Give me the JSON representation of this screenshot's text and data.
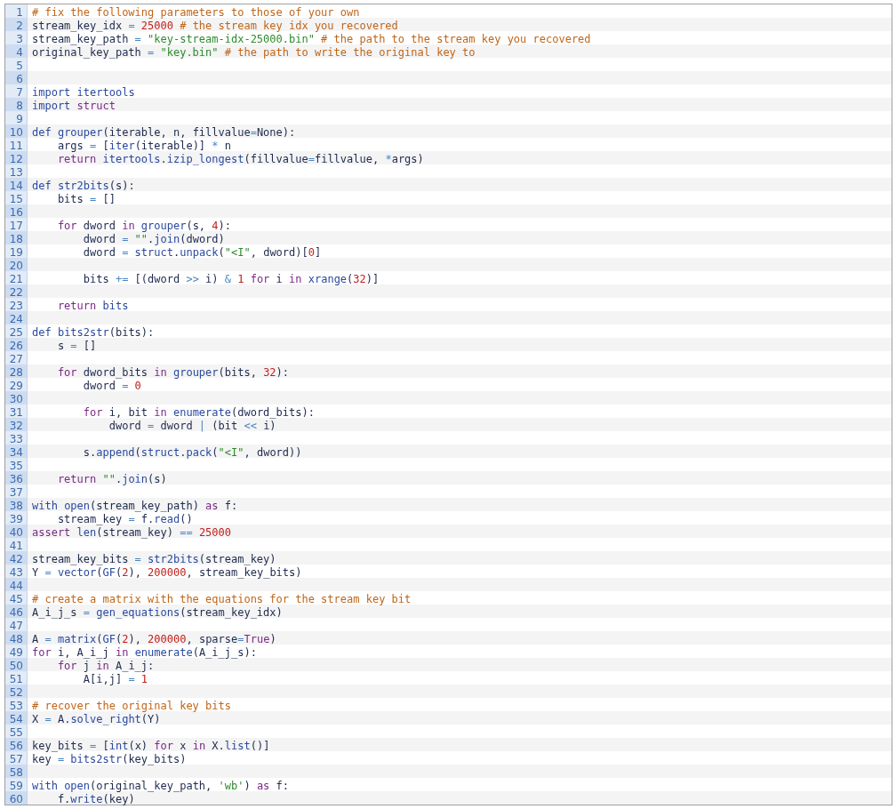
{
  "code_lines": [
    {
      "number": "1",
      "tokens": [
        {
          "kind": "comment",
          "text": "# fix the following parameters to those of your own"
        }
      ]
    },
    {
      "number": "2",
      "tokens": [
        {
          "kind": "text",
          "text": "stream_key_idx "
        },
        {
          "kind": "op",
          "text": "= "
        },
        {
          "kind": "num",
          "text": "25000"
        },
        {
          "kind": "comment",
          "text": " # the stream key idx you recovered"
        }
      ]
    },
    {
      "number": "3",
      "tokens": [
        {
          "kind": "text",
          "text": "stream_key_path "
        },
        {
          "kind": "op",
          "text": "= "
        },
        {
          "kind": "str",
          "text": "\"key-stream-idx-25000.bin\""
        },
        {
          "kind": "comment",
          "text": " # the path to the stream key you recovered"
        }
      ]
    },
    {
      "number": "4",
      "tokens": [
        {
          "kind": "text",
          "text": "original_key_path "
        },
        {
          "kind": "op",
          "text": "= "
        },
        {
          "kind": "str",
          "text": "\"key.bin\""
        },
        {
          "kind": "comment",
          "text": " # the path to write the original key to"
        }
      ]
    },
    {
      "number": "5"
    },
    {
      "number": "6"
    },
    {
      "number": "7",
      "tokens": [
        {
          "kind": "fn",
          "text": "import "
        },
        {
          "kind": "fn",
          "text": "itertools"
        }
      ]
    },
    {
      "number": "8",
      "tokens": [
        {
          "kind": "fn",
          "text": "import "
        },
        {
          "kind": "kw",
          "text": "struct"
        }
      ]
    },
    {
      "number": "9"
    },
    {
      "number": "10",
      "tokens": [
        {
          "kind": "fn",
          "text": "def "
        },
        {
          "kind": "fn",
          "text": "grouper"
        },
        {
          "kind": "text",
          "text": "(iterable, n, fillvalue"
        },
        {
          "kind": "op",
          "text": "="
        },
        {
          "kind": "text",
          "text": "None):"
        }
      ]
    },
    {
      "number": "11",
      "tokens": [
        {
          "kind": "text",
          "text": "    args "
        },
        {
          "kind": "op",
          "text": "="
        },
        {
          "kind": "text",
          "text": " ["
        },
        {
          "kind": "fn",
          "text": "iter"
        },
        {
          "kind": "text",
          "text": "(iterable)] "
        },
        {
          "kind": "op",
          "text": "*"
        },
        {
          "kind": "text",
          "text": " n"
        }
      ]
    },
    {
      "number": "12",
      "tokens": [
        {
          "kind": "kw",
          "text": "    return "
        },
        {
          "kind": "fn",
          "text": "itertools"
        },
        {
          "kind": "text",
          "text": "."
        },
        {
          "kind": "fn",
          "text": "izip_longest"
        },
        {
          "kind": "text",
          "text": "(fillvalue"
        },
        {
          "kind": "op",
          "text": "="
        },
        {
          "kind": "text",
          "text": "fillvalue, "
        },
        {
          "kind": "op",
          "text": "*"
        },
        {
          "kind": "text",
          "text": "args)"
        }
      ]
    },
    {
      "number": "13"
    },
    {
      "number": "14",
      "tokens": [
        {
          "kind": "fn",
          "text": "def "
        },
        {
          "kind": "fn",
          "text": "str2bits"
        },
        {
          "kind": "text",
          "text": "(s):"
        }
      ]
    },
    {
      "number": "15",
      "tokens": [
        {
          "kind": "text",
          "text": "    bits "
        },
        {
          "kind": "op",
          "text": "="
        },
        {
          "kind": "text",
          "text": " []"
        }
      ]
    },
    {
      "number": "16"
    },
    {
      "number": "17",
      "tokens": [
        {
          "kind": "kw",
          "text": "    for"
        },
        {
          "kind": "text",
          "text": " dword "
        },
        {
          "kind": "kw",
          "text": "in "
        },
        {
          "kind": "fn",
          "text": "grouper"
        },
        {
          "kind": "text",
          "text": "(s, "
        },
        {
          "kind": "num",
          "text": "4"
        },
        {
          "kind": "text",
          "text": "):"
        }
      ]
    },
    {
      "number": "18",
      "tokens": [
        {
          "kind": "text",
          "text": "        dword "
        },
        {
          "kind": "op",
          "text": "= "
        },
        {
          "kind": "str",
          "text": "\"\""
        },
        {
          "kind": "text",
          "text": "."
        },
        {
          "kind": "fn",
          "text": "join"
        },
        {
          "kind": "text",
          "text": "(dword)"
        }
      ]
    },
    {
      "number": "19",
      "tokens": [
        {
          "kind": "text",
          "text": "        dword "
        },
        {
          "kind": "op",
          "text": "= "
        },
        {
          "kind": "fn",
          "text": "struct"
        },
        {
          "kind": "text",
          "text": "."
        },
        {
          "kind": "fn",
          "text": "unpack"
        },
        {
          "kind": "text",
          "text": "("
        },
        {
          "kind": "str",
          "text": "\"<I\""
        },
        {
          "kind": "text",
          "text": ", dword)["
        },
        {
          "kind": "num",
          "text": "0"
        },
        {
          "kind": "text",
          "text": "]"
        }
      ]
    },
    {
      "number": "20"
    },
    {
      "number": "21",
      "tokens": [
        {
          "kind": "text",
          "text": "        bits "
        },
        {
          "kind": "op",
          "text": "+="
        },
        {
          "kind": "text",
          "text": " [(dword "
        },
        {
          "kind": "op",
          "text": ">>"
        },
        {
          "kind": "text",
          "text": " i) "
        },
        {
          "kind": "op",
          "text": "& "
        },
        {
          "kind": "num",
          "text": "1 "
        },
        {
          "kind": "kw",
          "text": "for"
        },
        {
          "kind": "text",
          "text": " i "
        },
        {
          "kind": "kw",
          "text": "in "
        },
        {
          "kind": "fn",
          "text": "xrange"
        },
        {
          "kind": "text",
          "text": "("
        },
        {
          "kind": "num",
          "text": "32"
        },
        {
          "kind": "text",
          "text": ")]"
        }
      ]
    },
    {
      "number": "22"
    },
    {
      "number": "23",
      "tokens": [
        {
          "kind": "kw",
          "text": "    return "
        },
        {
          "kind": "fn",
          "text": "bits"
        }
      ]
    },
    {
      "number": "24"
    },
    {
      "number": "25",
      "tokens": [
        {
          "kind": "fn",
          "text": "def "
        },
        {
          "kind": "fn",
          "text": "bits2str"
        },
        {
          "kind": "text",
          "text": "(bits):"
        }
      ]
    },
    {
      "number": "26",
      "tokens": [
        {
          "kind": "text",
          "text": "    s "
        },
        {
          "kind": "op",
          "text": "="
        },
        {
          "kind": "text",
          "text": " []"
        }
      ]
    },
    {
      "number": "27"
    },
    {
      "number": "28",
      "tokens": [
        {
          "kind": "kw",
          "text": "    for"
        },
        {
          "kind": "text",
          "text": " dword_bits "
        },
        {
          "kind": "kw",
          "text": "in "
        },
        {
          "kind": "fn",
          "text": "grouper"
        },
        {
          "kind": "text",
          "text": "(bits, "
        },
        {
          "kind": "num",
          "text": "32"
        },
        {
          "kind": "text",
          "text": "):"
        }
      ]
    },
    {
      "number": "29",
      "tokens": [
        {
          "kind": "text",
          "text": "        dword "
        },
        {
          "kind": "op",
          "text": "= "
        },
        {
          "kind": "num",
          "text": "0"
        }
      ]
    },
    {
      "number": "30"
    },
    {
      "number": "31",
      "tokens": [
        {
          "kind": "kw",
          "text": "        for"
        },
        {
          "kind": "text",
          "text": " i, bit "
        },
        {
          "kind": "kw",
          "text": "in "
        },
        {
          "kind": "fn",
          "text": "enumerate"
        },
        {
          "kind": "text",
          "text": "(dword_bits):"
        }
      ]
    },
    {
      "number": "32",
      "tokens": [
        {
          "kind": "text",
          "text": "            dword "
        },
        {
          "kind": "op",
          "text": "="
        },
        {
          "kind": "text",
          "text": " dword "
        },
        {
          "kind": "op",
          "text": "|"
        },
        {
          "kind": "text",
          "text": " (bit "
        },
        {
          "kind": "op",
          "text": "<<"
        },
        {
          "kind": "text",
          "text": " i)"
        }
      ]
    },
    {
      "number": "33"
    },
    {
      "number": "34",
      "tokens": [
        {
          "kind": "text",
          "text": "        s."
        },
        {
          "kind": "fn",
          "text": "append"
        },
        {
          "kind": "text",
          "text": "("
        },
        {
          "kind": "fn",
          "text": "struct"
        },
        {
          "kind": "text",
          "text": "."
        },
        {
          "kind": "fn",
          "text": "pack"
        },
        {
          "kind": "text",
          "text": "("
        },
        {
          "kind": "str",
          "text": "\"<I\""
        },
        {
          "kind": "text",
          "text": ", dword))"
        }
      ]
    },
    {
      "number": "35"
    },
    {
      "number": "36",
      "tokens": [
        {
          "kind": "kw",
          "text": "    return "
        },
        {
          "kind": "str",
          "text": "\"\""
        },
        {
          "kind": "text",
          "text": "."
        },
        {
          "kind": "fn",
          "text": "join"
        },
        {
          "kind": "text",
          "text": "(s)"
        }
      ]
    },
    {
      "number": "37"
    },
    {
      "number": "38",
      "tokens": [
        {
          "kind": "fn",
          "text": "with "
        },
        {
          "kind": "fn",
          "text": "open"
        },
        {
          "kind": "text",
          "text": "(stream_key_path) "
        },
        {
          "kind": "kw",
          "text": "as"
        },
        {
          "kind": "text",
          "text": " f:"
        }
      ]
    },
    {
      "number": "39",
      "tokens": [
        {
          "kind": "text",
          "text": "    stream_key "
        },
        {
          "kind": "op",
          "text": "="
        },
        {
          "kind": "text",
          "text": " f."
        },
        {
          "kind": "fn",
          "text": "read"
        },
        {
          "kind": "text",
          "text": "()"
        }
      ]
    },
    {
      "number": "40",
      "tokens": [
        {
          "kind": "kw",
          "text": "assert "
        },
        {
          "kind": "fn",
          "text": "len"
        },
        {
          "kind": "text",
          "text": "(stream_key) "
        },
        {
          "kind": "op",
          "text": "== "
        },
        {
          "kind": "num",
          "text": "25000"
        }
      ]
    },
    {
      "number": "41"
    },
    {
      "number": "42",
      "tokens": [
        {
          "kind": "text",
          "text": "stream_key_bits "
        },
        {
          "kind": "op",
          "text": "= "
        },
        {
          "kind": "fn",
          "text": "str2bits"
        },
        {
          "kind": "text",
          "text": "(stream_key)"
        }
      ]
    },
    {
      "number": "43",
      "tokens": [
        {
          "kind": "text",
          "text": "Y "
        },
        {
          "kind": "op",
          "text": "= "
        },
        {
          "kind": "fn",
          "text": "vector"
        },
        {
          "kind": "text",
          "text": "("
        },
        {
          "kind": "fn",
          "text": "GF"
        },
        {
          "kind": "text",
          "text": "("
        },
        {
          "kind": "num",
          "text": "2"
        },
        {
          "kind": "text",
          "text": "), "
        },
        {
          "kind": "num",
          "text": "200000"
        },
        {
          "kind": "text",
          "text": ", stream_key_bits)"
        }
      ]
    },
    {
      "number": "44"
    },
    {
      "number": "45",
      "tokens": [
        {
          "kind": "comment",
          "text": "# create a matrix with the equations for the stream key bit"
        }
      ]
    },
    {
      "number": "46",
      "tokens": [
        {
          "kind": "text",
          "text": "A_i_j_s "
        },
        {
          "kind": "op",
          "text": "= "
        },
        {
          "kind": "fn",
          "text": "gen_equations"
        },
        {
          "kind": "text",
          "text": "(stream_key_idx)"
        }
      ]
    },
    {
      "number": "47"
    },
    {
      "number": "48",
      "tokens": [
        {
          "kind": "text",
          "text": "A "
        },
        {
          "kind": "op",
          "text": "= "
        },
        {
          "kind": "fn",
          "text": "matrix"
        },
        {
          "kind": "text",
          "text": "("
        },
        {
          "kind": "fn",
          "text": "GF"
        },
        {
          "kind": "text",
          "text": "("
        },
        {
          "kind": "num",
          "text": "2"
        },
        {
          "kind": "text",
          "text": "), "
        },
        {
          "kind": "num",
          "text": "200000"
        },
        {
          "kind": "text",
          "text": ", sparse"
        },
        {
          "kind": "op",
          "text": "="
        },
        {
          "kind": "kw",
          "text": "True"
        },
        {
          "kind": "text",
          "text": ")"
        }
      ]
    },
    {
      "number": "49",
      "tokens": [
        {
          "kind": "kw",
          "text": "for"
        },
        {
          "kind": "text",
          "text": " i, A_i_j "
        },
        {
          "kind": "kw",
          "text": "in "
        },
        {
          "kind": "fn",
          "text": "enumerate"
        },
        {
          "kind": "text",
          "text": "(A_i_j_s):"
        }
      ]
    },
    {
      "number": "50",
      "tokens": [
        {
          "kind": "kw",
          "text": "    for"
        },
        {
          "kind": "text",
          "text": " j "
        },
        {
          "kind": "kw",
          "text": "in"
        },
        {
          "kind": "text",
          "text": " A_i_j:"
        }
      ]
    },
    {
      "number": "51",
      "tokens": [
        {
          "kind": "text",
          "text": "        A[i,j] "
        },
        {
          "kind": "op",
          "text": "= "
        },
        {
          "kind": "num",
          "text": "1"
        }
      ]
    },
    {
      "number": "52"
    },
    {
      "number": "53",
      "tokens": [
        {
          "kind": "comment",
          "text": "# recover the original key bits"
        }
      ]
    },
    {
      "number": "54",
      "tokens": [
        {
          "kind": "text",
          "text": "X "
        },
        {
          "kind": "op",
          "text": "="
        },
        {
          "kind": "text",
          "text": " A."
        },
        {
          "kind": "fn",
          "text": "solve_right"
        },
        {
          "kind": "text",
          "text": "(Y)"
        }
      ]
    },
    {
      "number": "55"
    },
    {
      "number": "56",
      "tokens": [
        {
          "kind": "text",
          "text": "key_bits "
        },
        {
          "kind": "op",
          "text": "="
        },
        {
          "kind": "text",
          "text": " ["
        },
        {
          "kind": "fn",
          "text": "int"
        },
        {
          "kind": "text",
          "text": "(x) "
        },
        {
          "kind": "kw",
          "text": "for"
        },
        {
          "kind": "text",
          "text": " x "
        },
        {
          "kind": "kw",
          "text": "in"
        },
        {
          "kind": "text",
          "text": " X."
        },
        {
          "kind": "fn",
          "text": "list"
        },
        {
          "kind": "text",
          "text": "()]"
        }
      ]
    },
    {
      "number": "57",
      "tokens": [
        {
          "kind": "text",
          "text": "key "
        },
        {
          "kind": "op",
          "text": "= "
        },
        {
          "kind": "fn",
          "text": "bits2str"
        },
        {
          "kind": "text",
          "text": "(key_bits)"
        }
      ]
    },
    {
      "number": "58"
    },
    {
      "number": "59",
      "tokens": [
        {
          "kind": "fn",
          "text": "with "
        },
        {
          "kind": "fn",
          "text": "open"
        },
        {
          "kind": "text",
          "text": "(original_key_path, "
        },
        {
          "kind": "str",
          "text": "'wb'"
        },
        {
          "kind": "text",
          "text": ") "
        },
        {
          "kind": "kw",
          "text": "as"
        },
        {
          "kind": "text",
          "text": " f:"
        }
      ]
    },
    {
      "number": "60",
      "tokens": [
        {
          "kind": "text",
          "text": "    f."
        },
        {
          "kind": "fn",
          "text": "write"
        },
        {
          "kind": "text",
          "text": "(key)"
        }
      ]
    }
  ]
}
